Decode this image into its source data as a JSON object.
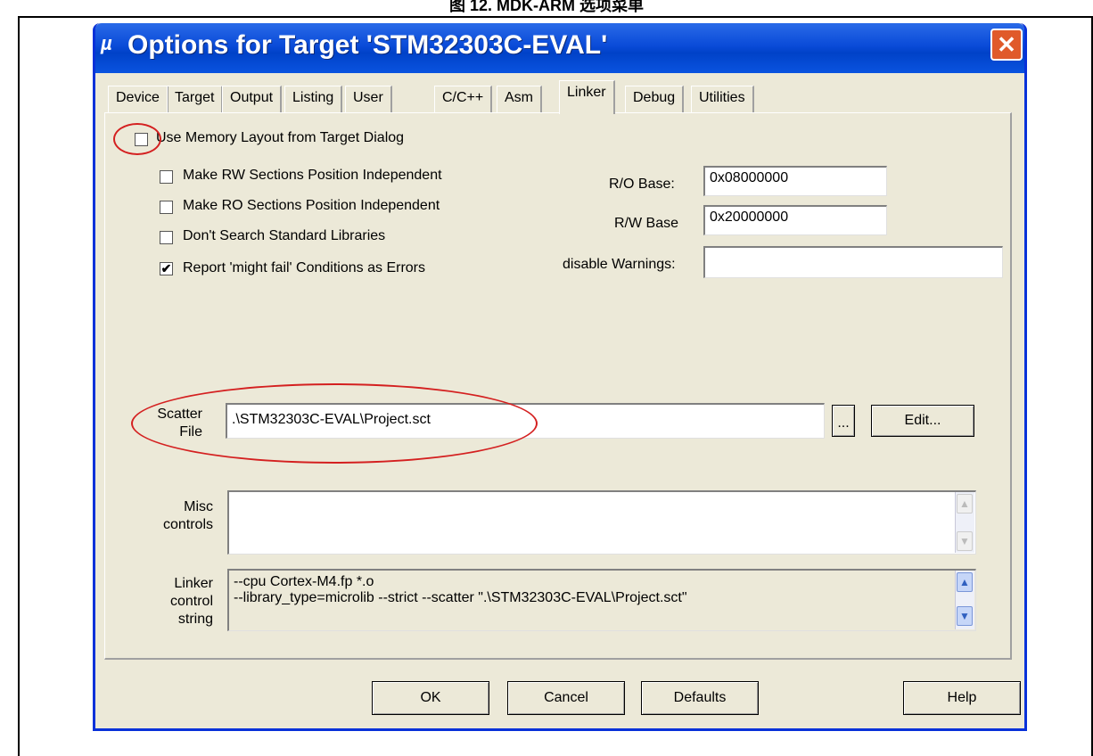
{
  "caption": "图 12. MDK-ARM 选项菜单",
  "window": {
    "title": "Options for Target 'STM32303C-EVAL'",
    "icon": "keil-icon",
    "close": "✕"
  },
  "tabs": [
    "Device",
    "Target",
    "Output",
    "Listing",
    "User",
    "C/C++",
    "Asm",
    "Linker",
    "Debug",
    "Utilities"
  ],
  "active_tab": "Linker",
  "options": {
    "use_memory_layout": {
      "label": "Use Memory Layout from Target Dialog",
      "checked": false
    },
    "rw_pos_indep": {
      "label": "Make RW Sections Position Independent",
      "checked": false
    },
    "ro_pos_indep": {
      "label": "Make RO Sections Position Independent",
      "checked": false
    },
    "dont_search_libs": {
      "label": "Don't Search Standard Libraries",
      "checked": false
    },
    "report_might_fail": {
      "label": "Report 'might fail' Conditions as Errors",
      "checked": true
    }
  },
  "fields": {
    "ro_base_label": "R/O Base:",
    "ro_base_value": "0x08000000",
    "rw_base_label": "R/W Base",
    "rw_base_value": "0x20000000",
    "disable_warnings_label": "disable Warnings:",
    "disable_warnings_value": ""
  },
  "scatter": {
    "label_1": "Scatter",
    "label_2": "File",
    "value": ".\\STM32303C-EVAL\\Project.sct",
    "browse_label": "...",
    "edit_label": "Edit..."
  },
  "misc": {
    "label_1": "Misc",
    "label_2": "controls",
    "value": ""
  },
  "linker_control": {
    "label_1": "Linker",
    "label_2": "control",
    "label_3": "string",
    "line_1": "--cpu Cortex-M4.fp *.o",
    "line_2": "--library_type=microlib --strict --scatter \".\\STM32303C-EVAL\\Project.sct\""
  },
  "buttons": {
    "ok": "OK",
    "cancel": "Cancel",
    "defaults": "Defaults",
    "help": "Help"
  },
  "colors": {
    "titlebar": "#0a4bd8",
    "dialog_bg": "#ece9d8",
    "close_button": "#e05a2a",
    "annotation_ring": "#d42020"
  }
}
